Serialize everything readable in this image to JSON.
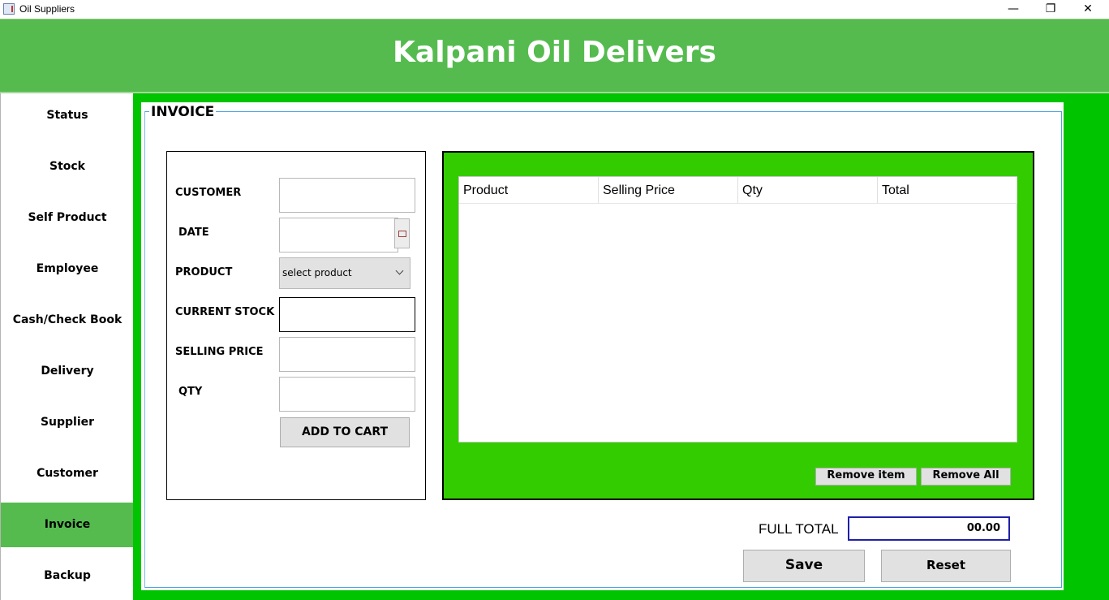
{
  "window": {
    "title": "Oil Suppliers",
    "controls": {
      "minimize": "—",
      "restore": "❐",
      "close": "✕"
    }
  },
  "header": {
    "title": "Kalpani Oil Delivers"
  },
  "sidebar": {
    "items": [
      {
        "label": "Status"
      },
      {
        "label": "Stock"
      },
      {
        "label": "Self Product"
      },
      {
        "label": "Employee"
      },
      {
        "label": "Cash/Check Book"
      },
      {
        "label": "Delivery"
      },
      {
        "label": "Supplier"
      },
      {
        "label": "Customer"
      },
      {
        "label": "Invoice",
        "active": true
      },
      {
        "label": "Backup"
      }
    ]
  },
  "invoice": {
    "section_title": "INVOICE",
    "form": {
      "customer_label": "CUSTOMER",
      "customer_value": "",
      "date_label": "DATE",
      "date_value": "",
      "product_label": "PRODUCT",
      "product_selected": "select product",
      "current_stock_label": "CURRENT STOCK",
      "current_stock_value": "",
      "selling_price_label": "SELLING PRICE",
      "selling_price_value": "",
      "qty_label": "QTY",
      "qty_value": "",
      "add_to_cart_label": "ADD TO CART"
    },
    "cart": {
      "columns": [
        "Product",
        "Selling Price",
        "Qty",
        "Total"
      ],
      "rows": [],
      "remove_item_label": "Remove item",
      "remove_all_label": "Remove All"
    },
    "totals": {
      "full_total_label": "FULL TOTAL",
      "full_total_value": "00.00"
    },
    "actions": {
      "save_label": "Save",
      "reset_label": "Reset"
    }
  },
  "colors": {
    "header_green": "#55bb4f",
    "content_green": "#00c400",
    "cart_green": "#33cc00",
    "total_border": "#1f1fa8"
  },
  "icons": {
    "app": "java-app-icon",
    "date_picker": "calendar-icon",
    "select": "chevron-down-icon"
  }
}
